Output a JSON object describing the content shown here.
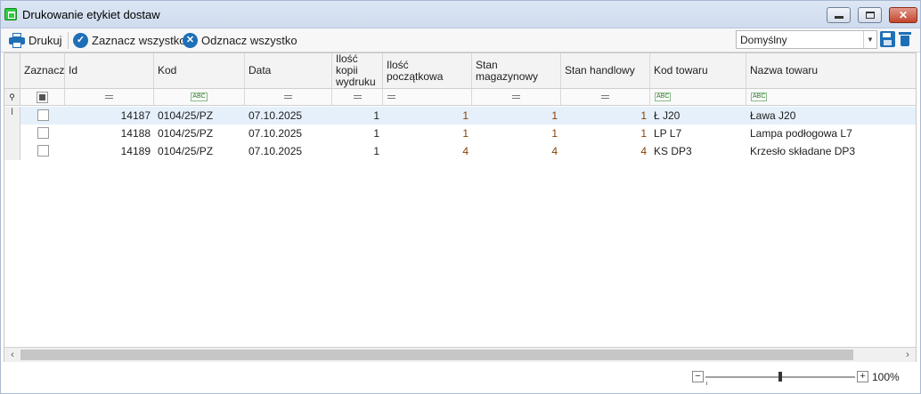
{
  "window": {
    "title": "Drukowanie etykiet dostaw",
    "close_glyph": "✕"
  },
  "toolbar": {
    "print_label": "Drukuj",
    "select_all_label": "Zaznacz wszystko",
    "deselect_all_label": "Odznacz wszystko",
    "layout_combo_value": "Domyślny"
  },
  "grid": {
    "columns": [
      "Zaznacz",
      "Id",
      "Kod",
      "Data",
      "Ilość kopii wydruku",
      "Ilość początkowa",
      "Stan magazynowy",
      "Stan handlowy",
      "Kod towaru",
      "Nazwa towaru"
    ],
    "filter_abc": "ABC",
    "rows": [
      {
        "indicator": "I",
        "checked": false,
        "id": "14187",
        "kod": "0104/25/PZ",
        "data": "07.10.2025",
        "kopie": "1",
        "poczatkowa": "1",
        "magazynowy": "1",
        "handlowy": "1",
        "kod_towaru": "Ł J20",
        "nazwa": "Ława J20"
      },
      {
        "indicator": "",
        "checked": false,
        "id": "14188",
        "kod": "0104/25/PZ",
        "data": "07.10.2025",
        "kopie": "1",
        "poczatkowa": "1",
        "magazynowy": "1",
        "handlowy": "1",
        "kod_towaru": "LP L7",
        "nazwa": "Lampa podłogowa L7"
      },
      {
        "indicator": "",
        "checked": false,
        "id": "14189",
        "kod": "0104/25/PZ",
        "data": "07.10.2025",
        "kopie": "1",
        "poczatkowa": "4",
        "magazynowy": "4",
        "handlowy": "4",
        "kod_towaru": "KS DP3",
        "nazwa": "Krzesło składane DP3"
      }
    ]
  },
  "status": {
    "zoom": "100%",
    "zoom_minus": "−",
    "zoom_plus": "+"
  }
}
